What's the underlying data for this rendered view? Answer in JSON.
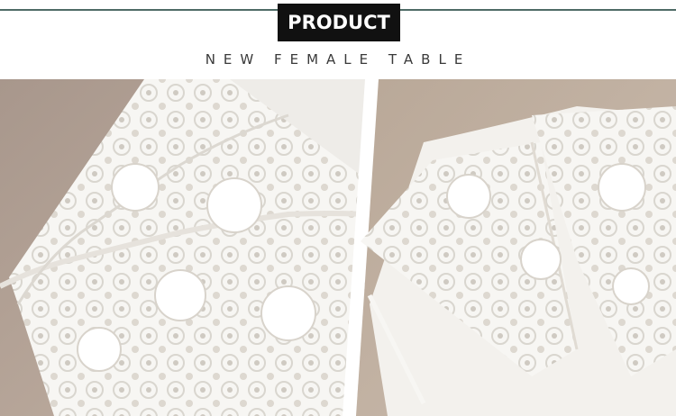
{
  "header": {
    "badge_label": "PRODUCT",
    "subtitle": "NEW FEMALE TABLE"
  },
  "images": [
    {
      "name": "lace-sleeve-closeup",
      "description_icon": "lace-icon"
    },
    {
      "name": "lace-collar-closeup",
      "description_icon": "lace-icon"
    }
  ],
  "colors": {
    "accent_rule": "#4f6b66",
    "badge_bg": "#111111",
    "badge_text": "#ffffff",
    "subtitle_text": "#3a3a3a",
    "table_surface": "#b8a596",
    "fabric_white": "#f7f6f3"
  }
}
